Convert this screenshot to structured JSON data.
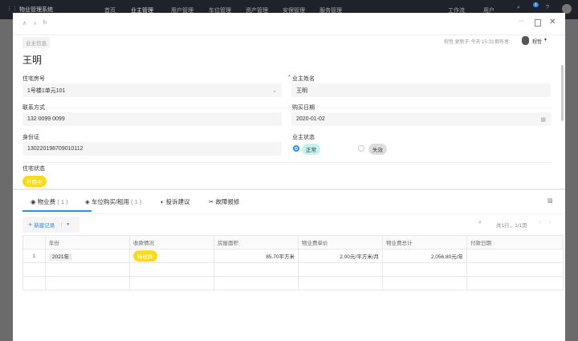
{
  "app": {
    "name": "物业管理系统",
    "nav": [
      "首页",
      "业主管理",
      "用户管理",
      "车位管理",
      "资产管理",
      "安保管理",
      "服务管理"
    ],
    "workflow": "工作流",
    "users": "用户",
    "notif_count": "1"
  },
  "record": {
    "section_tag": "业主信息",
    "title": "王明",
    "meta": "程哲 更新于 今天 15:33",
    "owner_label": "拥有者:",
    "owner": "程哲"
  },
  "form": {
    "room_label": "住宅房号",
    "room_value": "1号楼1单元101",
    "name_label": "业主姓名",
    "name_value": "王明",
    "phone_label": "联系方式",
    "phone_value": "132 0099 0099",
    "date_label": "购买日期",
    "date_value": "2020-01-02",
    "id_label": "身份证",
    "id_value": "130220198709010112",
    "status_label": "业主状态",
    "status_options": [
      "正常",
      "失效"
    ],
    "house_status_label": "住宅状态",
    "house_status_value": "外租中"
  },
  "tabs": [
    {
      "label": "物业费",
      "count": "( 1 )"
    },
    {
      "label": "车位购买/租用",
      "count": "( 1 )"
    },
    {
      "label": "投诉建议",
      "count": ""
    },
    {
      "label": "故障报修",
      "count": ""
    }
  ],
  "toolbar": {
    "new_record": "新建记录",
    "pagination": "共1行，1/1页"
  },
  "table": {
    "headers": [
      "年份",
      "收款情况",
      "房屋面积",
      "物业费单价",
      "物业费总计",
      "付款日期"
    ],
    "rows": [
      {
        "index": "1",
        "year": "2021年",
        "status": "待收款",
        "area": "85.70平方米",
        "price": "2.00元/平方米/月",
        "total": "2,056.80元/年",
        "paid": ""
      }
    ]
  },
  "colors": {
    "accent": "#2d8cf0",
    "yellow": "#fadb14"
  }
}
